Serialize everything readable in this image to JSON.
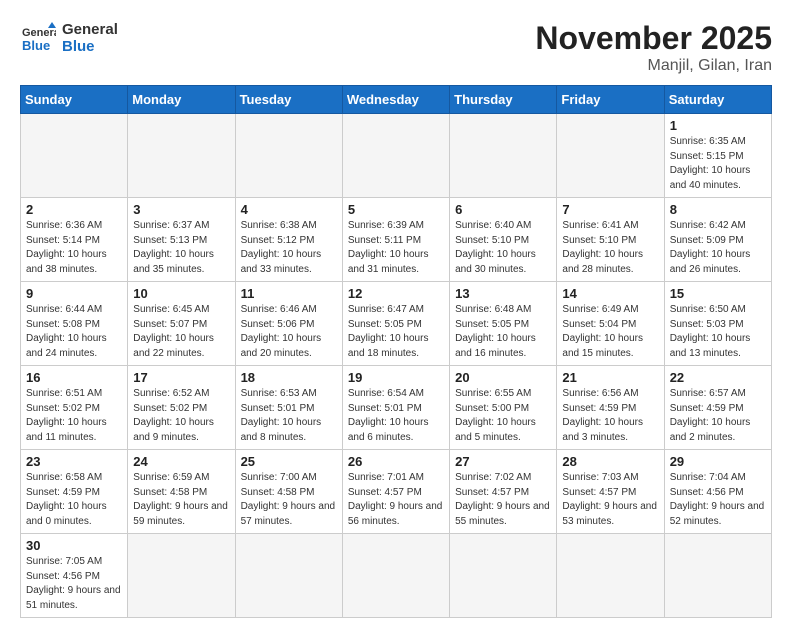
{
  "header": {
    "logo_general": "General",
    "logo_blue": "Blue",
    "month_title": "November 2025",
    "location": "Manjil, Gilan, Iran"
  },
  "weekdays": [
    "Sunday",
    "Monday",
    "Tuesday",
    "Wednesday",
    "Thursday",
    "Friday",
    "Saturday"
  ],
  "weeks": [
    [
      {
        "day": "",
        "empty": true
      },
      {
        "day": "",
        "empty": true
      },
      {
        "day": "",
        "empty": true
      },
      {
        "day": "",
        "empty": true
      },
      {
        "day": "",
        "empty": true
      },
      {
        "day": "",
        "empty": true
      },
      {
        "day": "1",
        "sunrise": "6:35 AM",
        "sunset": "5:15 PM",
        "daylight": "10 hours and 40 minutes."
      }
    ],
    [
      {
        "day": "2",
        "sunrise": "6:36 AM",
        "sunset": "5:14 PM",
        "daylight": "10 hours and 38 minutes."
      },
      {
        "day": "3",
        "sunrise": "6:37 AM",
        "sunset": "5:13 PM",
        "daylight": "10 hours and 35 minutes."
      },
      {
        "day": "4",
        "sunrise": "6:38 AM",
        "sunset": "5:12 PM",
        "daylight": "10 hours and 33 minutes."
      },
      {
        "day": "5",
        "sunrise": "6:39 AM",
        "sunset": "5:11 PM",
        "daylight": "10 hours and 31 minutes."
      },
      {
        "day": "6",
        "sunrise": "6:40 AM",
        "sunset": "5:10 PM",
        "daylight": "10 hours and 30 minutes."
      },
      {
        "day": "7",
        "sunrise": "6:41 AM",
        "sunset": "5:10 PM",
        "daylight": "10 hours and 28 minutes."
      },
      {
        "day": "8",
        "sunrise": "6:42 AM",
        "sunset": "5:09 PM",
        "daylight": "10 hours and 26 minutes."
      }
    ],
    [
      {
        "day": "9",
        "sunrise": "6:44 AM",
        "sunset": "5:08 PM",
        "daylight": "10 hours and 24 minutes."
      },
      {
        "day": "10",
        "sunrise": "6:45 AM",
        "sunset": "5:07 PM",
        "daylight": "10 hours and 22 minutes."
      },
      {
        "day": "11",
        "sunrise": "6:46 AM",
        "sunset": "5:06 PM",
        "daylight": "10 hours and 20 minutes."
      },
      {
        "day": "12",
        "sunrise": "6:47 AM",
        "sunset": "5:05 PM",
        "daylight": "10 hours and 18 minutes."
      },
      {
        "day": "13",
        "sunrise": "6:48 AM",
        "sunset": "5:05 PM",
        "daylight": "10 hours and 16 minutes."
      },
      {
        "day": "14",
        "sunrise": "6:49 AM",
        "sunset": "5:04 PM",
        "daylight": "10 hours and 15 minutes."
      },
      {
        "day": "15",
        "sunrise": "6:50 AM",
        "sunset": "5:03 PM",
        "daylight": "10 hours and 13 minutes."
      }
    ],
    [
      {
        "day": "16",
        "sunrise": "6:51 AM",
        "sunset": "5:02 PM",
        "daylight": "10 hours and 11 minutes."
      },
      {
        "day": "17",
        "sunrise": "6:52 AM",
        "sunset": "5:02 PM",
        "daylight": "10 hours and 9 minutes."
      },
      {
        "day": "18",
        "sunrise": "6:53 AM",
        "sunset": "5:01 PM",
        "daylight": "10 hours and 8 minutes."
      },
      {
        "day": "19",
        "sunrise": "6:54 AM",
        "sunset": "5:01 PM",
        "daylight": "10 hours and 6 minutes."
      },
      {
        "day": "20",
        "sunrise": "6:55 AM",
        "sunset": "5:00 PM",
        "daylight": "10 hours and 5 minutes."
      },
      {
        "day": "21",
        "sunrise": "6:56 AM",
        "sunset": "4:59 PM",
        "daylight": "10 hours and 3 minutes."
      },
      {
        "day": "22",
        "sunrise": "6:57 AM",
        "sunset": "4:59 PM",
        "daylight": "10 hours and 2 minutes."
      }
    ],
    [
      {
        "day": "23",
        "sunrise": "6:58 AM",
        "sunset": "4:59 PM",
        "daylight": "10 hours and 0 minutes."
      },
      {
        "day": "24",
        "sunrise": "6:59 AM",
        "sunset": "4:58 PM",
        "daylight": "9 hours and 59 minutes."
      },
      {
        "day": "25",
        "sunrise": "7:00 AM",
        "sunset": "4:58 PM",
        "daylight": "9 hours and 57 minutes."
      },
      {
        "day": "26",
        "sunrise": "7:01 AM",
        "sunset": "4:57 PM",
        "daylight": "9 hours and 56 minutes."
      },
      {
        "day": "27",
        "sunrise": "7:02 AM",
        "sunset": "4:57 PM",
        "daylight": "9 hours and 55 minutes."
      },
      {
        "day": "28",
        "sunrise": "7:03 AM",
        "sunset": "4:57 PM",
        "daylight": "9 hours and 53 minutes."
      },
      {
        "day": "29",
        "sunrise": "7:04 AM",
        "sunset": "4:56 PM",
        "daylight": "9 hours and 52 minutes."
      }
    ],
    [
      {
        "day": "30",
        "sunrise": "7:05 AM",
        "sunset": "4:56 PM",
        "daylight": "9 hours and 51 minutes."
      },
      {
        "day": "",
        "empty": true
      },
      {
        "day": "",
        "empty": true
      },
      {
        "day": "",
        "empty": true
      },
      {
        "day": "",
        "empty": true
      },
      {
        "day": "",
        "empty": true
      },
      {
        "day": "",
        "empty": true
      }
    ]
  ]
}
